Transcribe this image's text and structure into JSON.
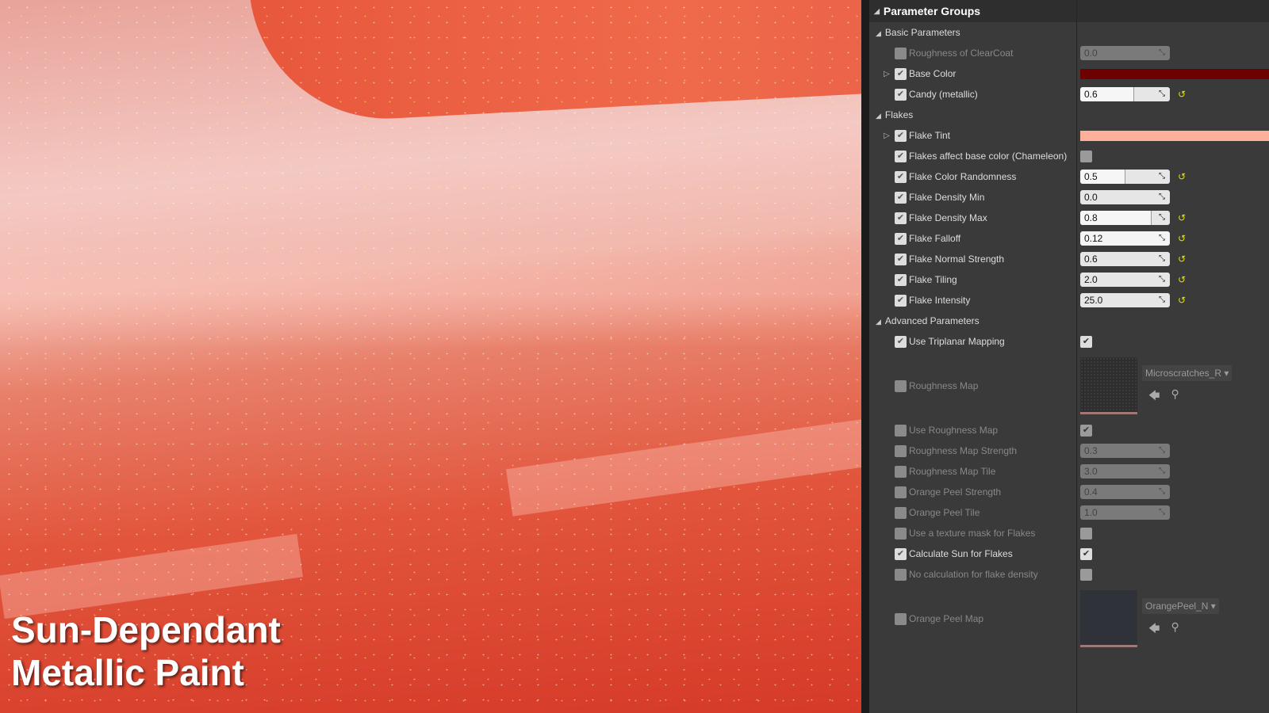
{
  "overlay_title": [
    "Sun-Dependant",
    "Metallic Paint"
  ],
  "panel": {
    "header": "Parameter Groups",
    "groups": [
      {
        "label": "Basic Parameters"
      },
      {
        "label": "Flakes"
      },
      {
        "label": "Advanced Parameters"
      }
    ],
    "rows": {
      "r0": {
        "label": "Roughness of ClearCoat",
        "value": "0.0"
      },
      "r1": {
        "label": "Base Color",
        "color": "#6e0000"
      },
      "r2": {
        "label": "Candy (metallic)",
        "value": "0.6",
        "fill": 0.6
      },
      "r3": {
        "label": "Flake Tint",
        "color": "#ffb09a"
      },
      "r4": {
        "label": "Flakes affect base color (Chameleon)"
      },
      "r5": {
        "label": "Flake Color Randomness",
        "value": "0.5",
        "fill": 0.5
      },
      "r6": {
        "label": "Flake Density Min",
        "value": "0.0"
      },
      "r7": {
        "label": "Flake Density Max",
        "value": "0.8",
        "fill": 0.8
      },
      "r8": {
        "label": "Flake Falloff",
        "value": "0.12"
      },
      "r9": {
        "label": "Flake Normal Strength",
        "value": "0.6"
      },
      "r10": {
        "label": "Flake Tiling",
        "value": "2.0"
      },
      "r11": {
        "label": "Flake Intensity",
        "value": "25.0"
      },
      "r12": {
        "label": "Use Triplanar Mapping"
      },
      "r13": {
        "label": "Roughness Map",
        "asset": "Microscratches_R"
      },
      "r14": {
        "label": "Use Roughness Map"
      },
      "r15": {
        "label": "Roughness Map Strength",
        "value": "0.3"
      },
      "r16": {
        "label": "Roughness Map Tile",
        "value": "3.0"
      },
      "r17": {
        "label": "Orange Peel Strength",
        "value": "0.4"
      },
      "r18": {
        "label": "Orange Peel Tile",
        "value": "1.0"
      },
      "r19": {
        "label": "Use a texture mask for Flakes"
      },
      "r20": {
        "label": "Calculate Sun for Flakes"
      },
      "r21": {
        "label": "No calculation for flake density"
      },
      "r22": {
        "label": "Orange Peel Map",
        "asset": "OrangePeel_N"
      }
    }
  }
}
